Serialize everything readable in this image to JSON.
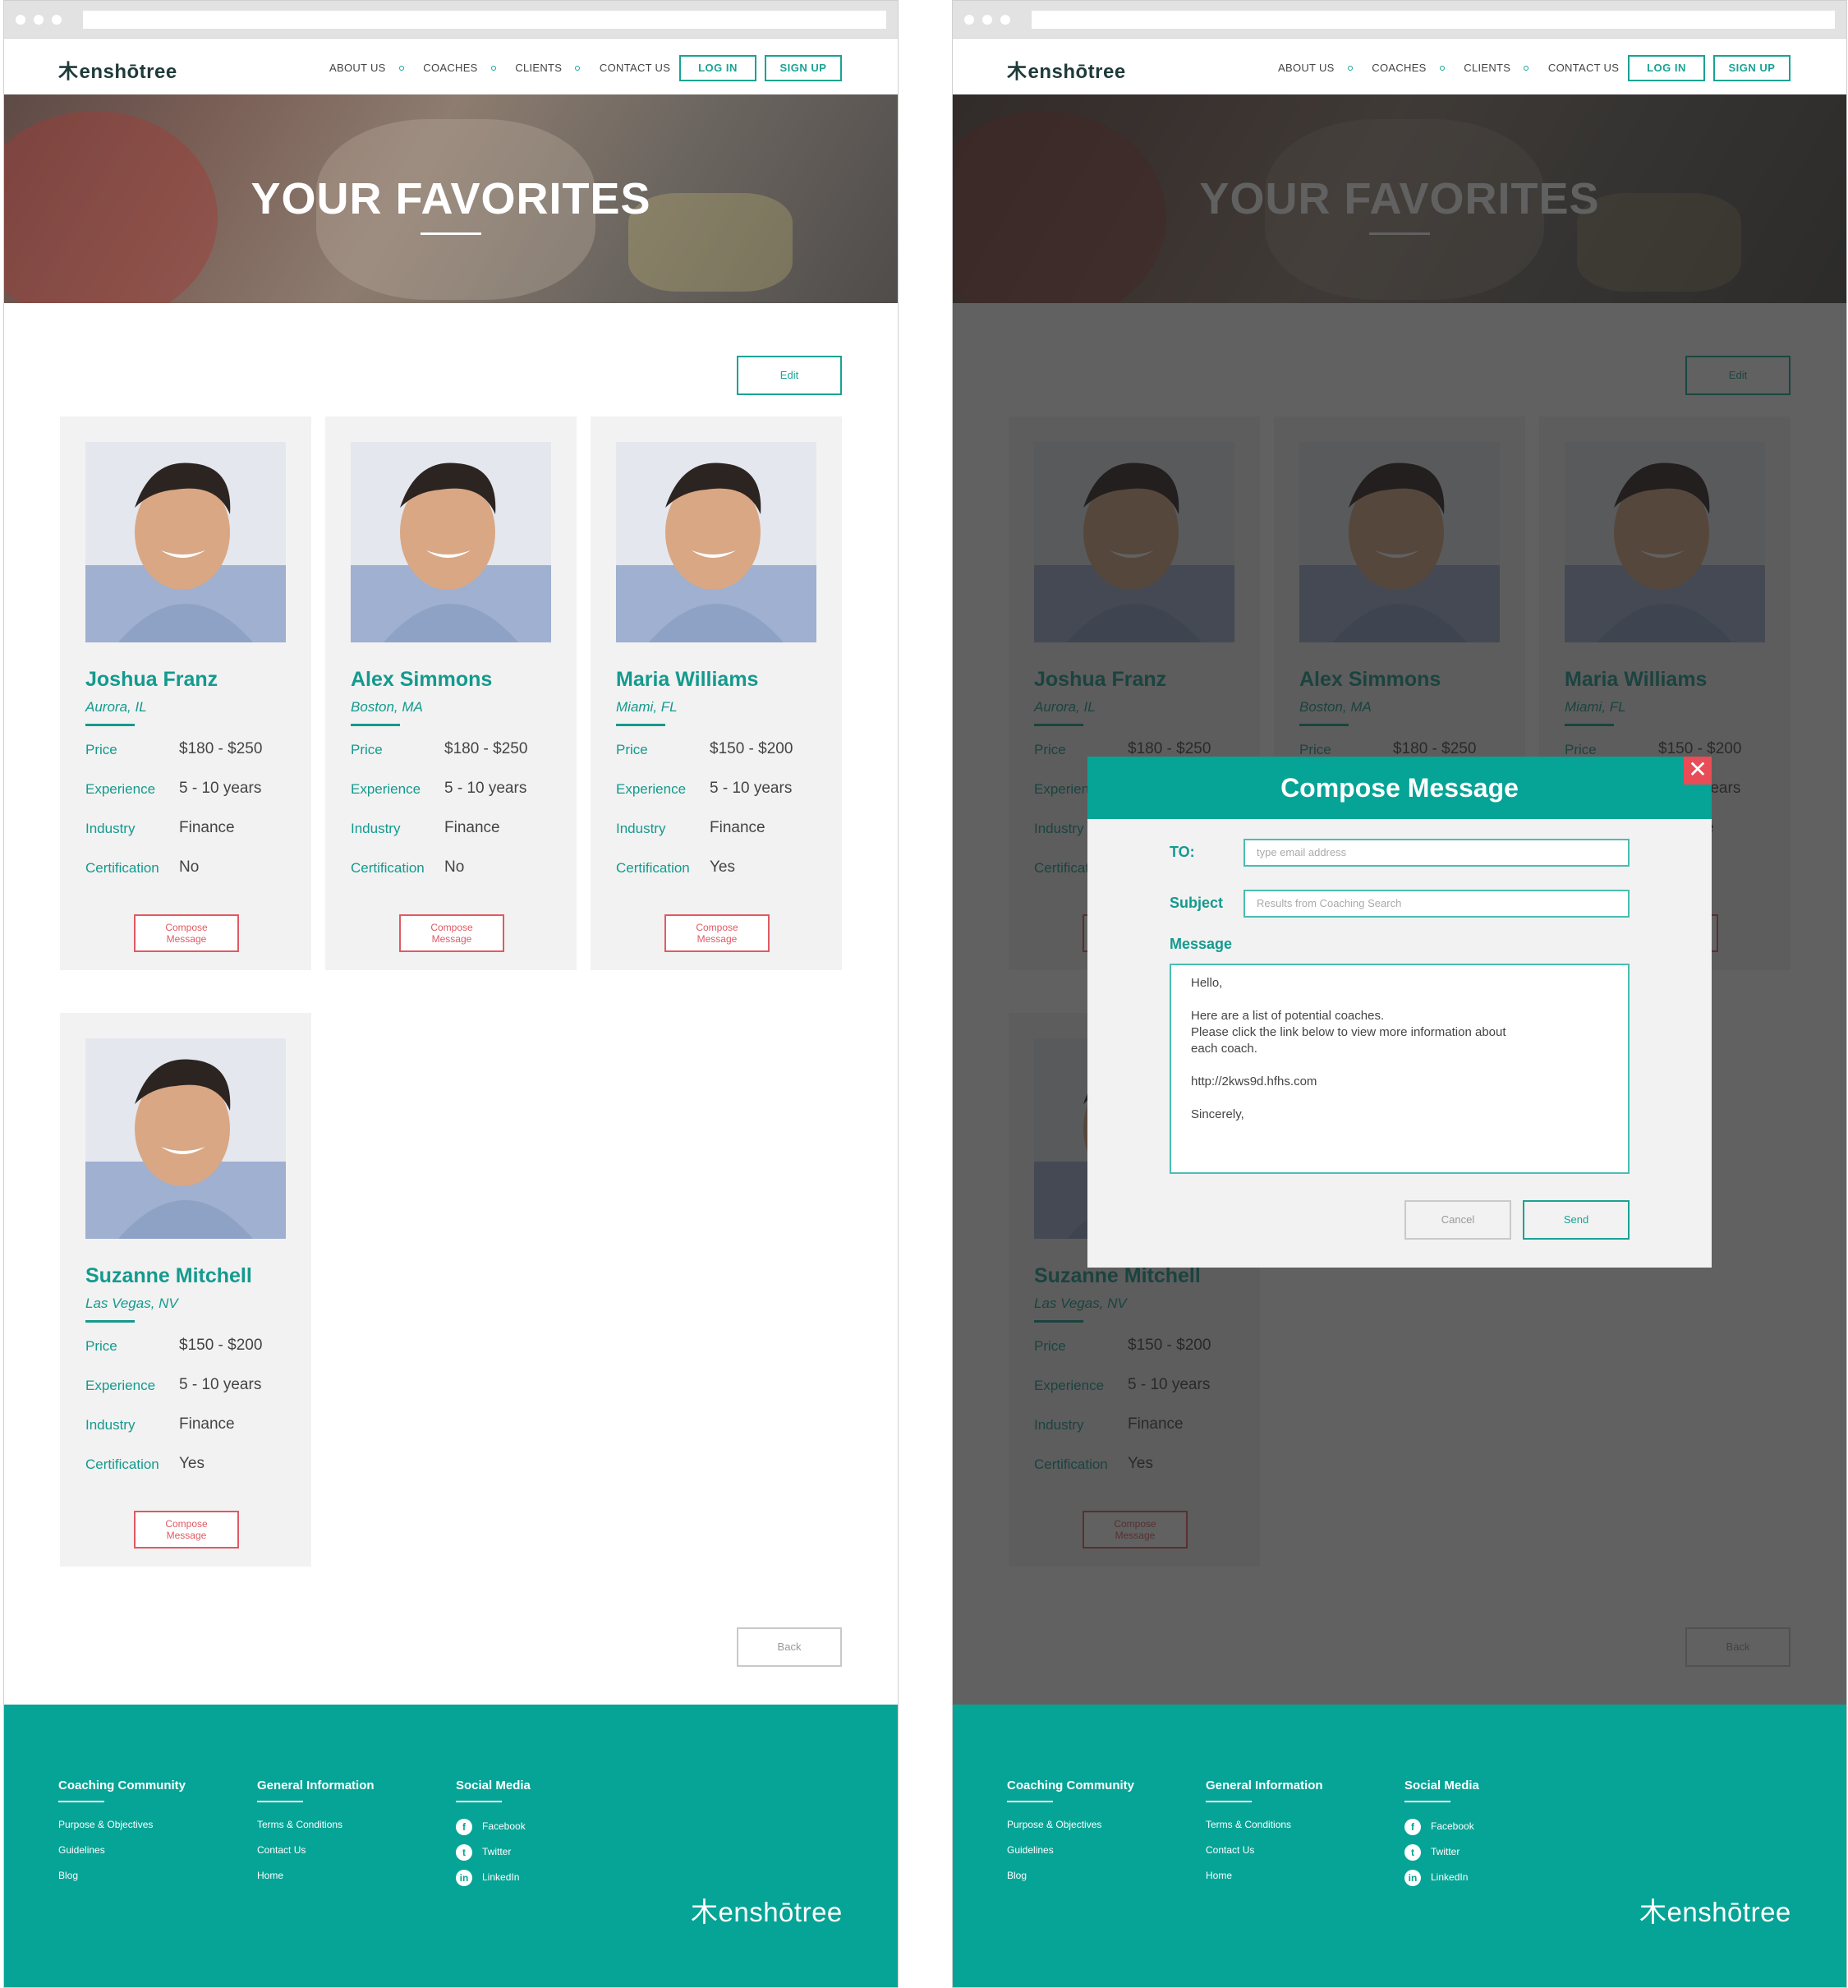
{
  "site": {
    "logo_prefix": "k",
    "logo_text": "enshōtree",
    "nav": [
      "ABOUT US",
      "COACHES",
      "CLIENTS",
      "CONTACT US"
    ],
    "login_label": "LOG IN",
    "signup_label": "SIGN UP"
  },
  "hero": {
    "title": "YOUR FAVORITES"
  },
  "page": {
    "edit_label": "Edit",
    "back_label": "Back"
  },
  "labels": {
    "price": "Price",
    "experience": "Experience",
    "industry": "Industry",
    "certification": "Certification",
    "compose_line1": "Compose",
    "compose_line2": "Message"
  },
  "coaches": [
    {
      "name": "Joshua Franz",
      "location": "Aurora, IL",
      "price": "$180 - $250",
      "experience": "5 - 10 years",
      "industry": "Finance",
      "certification": "No"
    },
    {
      "name": "Alex Simmons",
      "location": "Boston, MA",
      "price": "$180 - $250",
      "experience": "5 - 10 years",
      "industry": "Finance",
      "certification": "No"
    },
    {
      "name": "Maria Williams",
      "location": "Miami, FL",
      "price": "$150 - $200",
      "experience": "5 - 10 years",
      "industry": "Finance",
      "certification": "Yes"
    },
    {
      "name": "Suzanne Mitchell",
      "location": "Las Vegas, NV",
      "price": "$150 - $200",
      "experience": "5 - 10 years",
      "industry": "Finance",
      "certification": "Yes"
    }
  ],
  "footer": {
    "col1": {
      "title": "Coaching Community",
      "links": [
        "Purpose & Objectives",
        "Guidelines",
        "Blog"
      ]
    },
    "col2": {
      "title": "General Information",
      "links": [
        "Terms & Conditions",
        "Contact Us",
        "Home"
      ]
    },
    "col3": {
      "title": "Social Media",
      "links": [
        "Facebook",
        "Twitter",
        "LinkedIn"
      ],
      "icons": [
        "f",
        "t",
        "in"
      ]
    }
  },
  "modal": {
    "title": "Compose Message",
    "close_glyph": "✕",
    "to_label": "TO:",
    "to_placeholder": "type email address",
    "subject_label": "Subject",
    "subject_placeholder": "Results from Coaching Search",
    "message_label": "Message",
    "message_lines": {
      "greeting": "Hello,",
      "body1": "Here are a list of potential coaches.",
      "body2": "Please click the link below to view more information about",
      "body3": "each coach.",
      "link": "http://2kws9d.hfhs.com",
      "closing": "Sincerely,"
    },
    "cancel_label": "Cancel",
    "send_label": "Send"
  },
  "colors": {
    "teal": "#05a496",
    "accent_red": "#e05a63",
    "overlay": "#1e1e1e"
  }
}
